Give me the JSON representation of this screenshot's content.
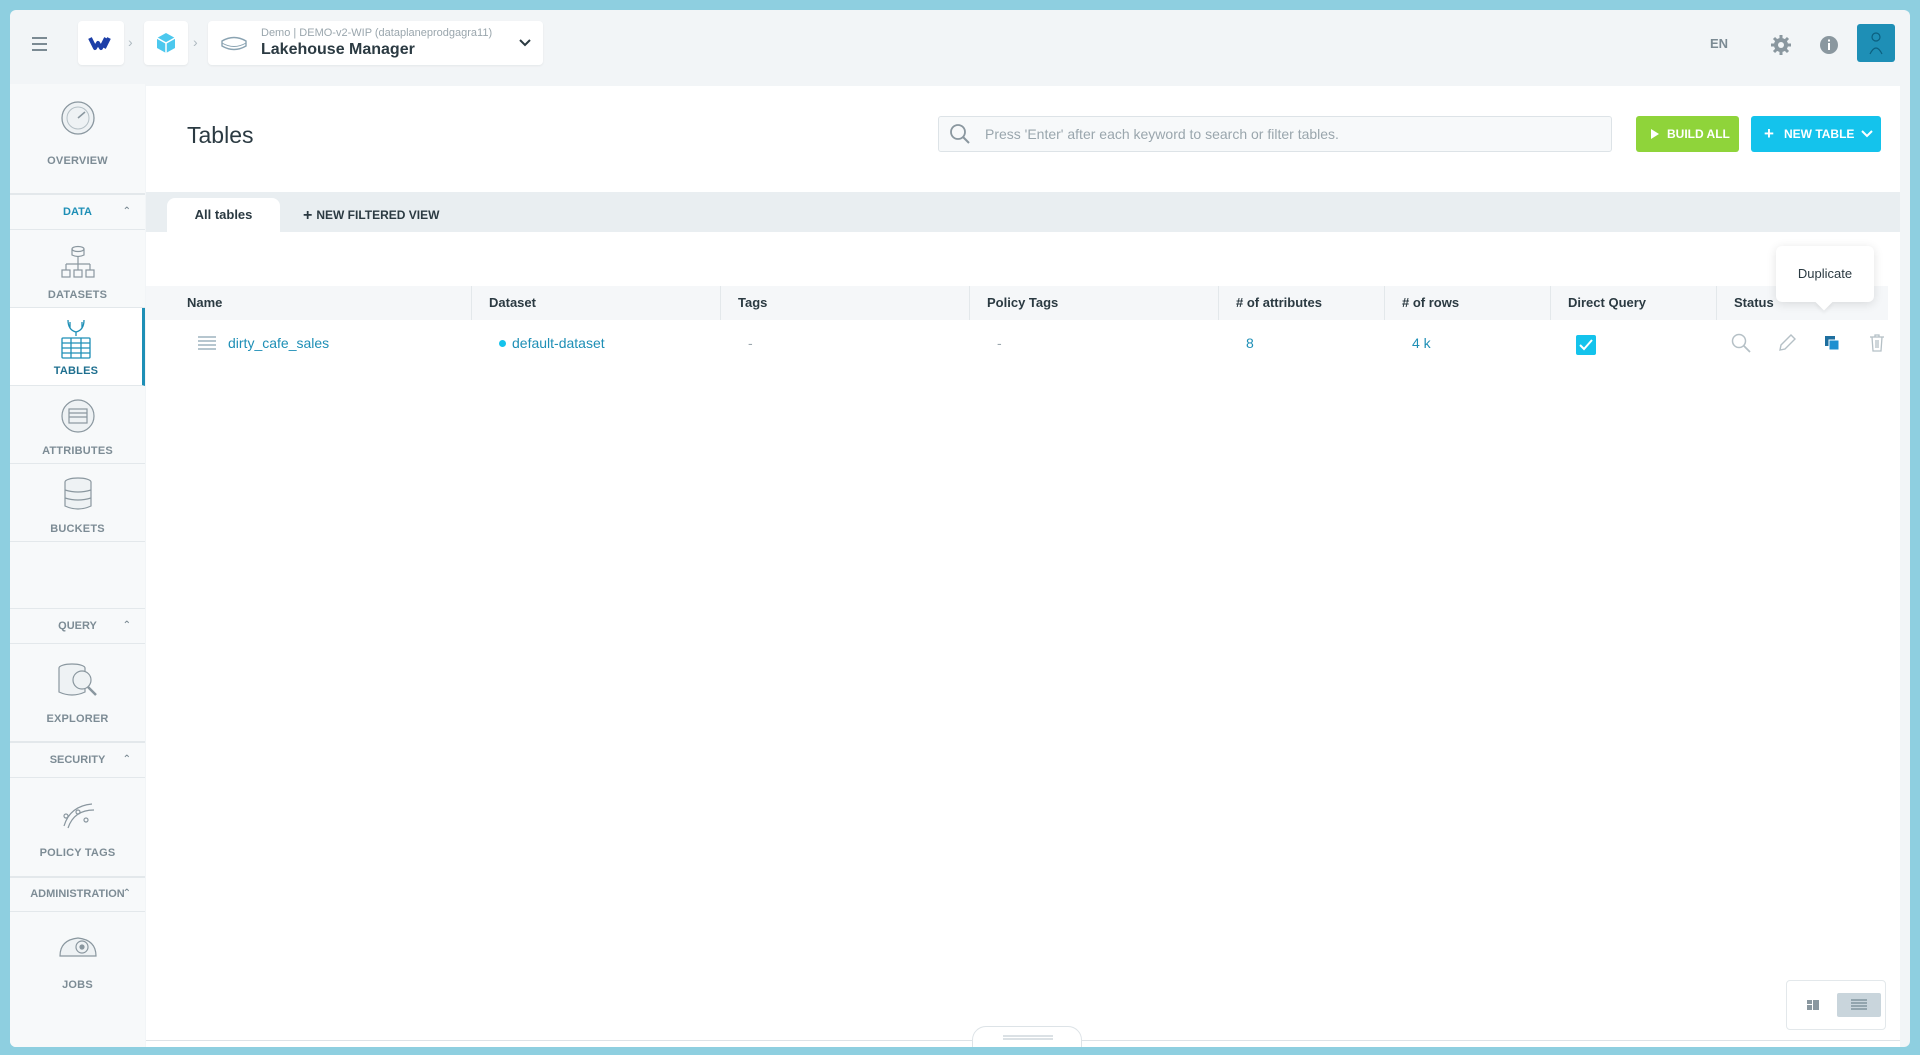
{
  "topbar": {
    "app_context": "Demo | DEMO-v2-WIP (dataplaneprodgagra11)",
    "app_title": "Lakehouse Manager",
    "language": "EN",
    "icons": [
      "menu-icon",
      "logo-icon",
      "cube-icon",
      "lakehouse-icon",
      "chevron-down-icon",
      "gear-icon",
      "info-icon",
      "user-avatar-icon"
    ]
  },
  "sidebar": {
    "overview": "OVERVIEW",
    "sections": {
      "data": "DATA",
      "query": "QUERY",
      "security": "SECURITY",
      "administration": "ADMINISTRATION"
    },
    "items": {
      "datasets": "DATASETS",
      "tables": "TABLES",
      "attributes": "ATTRIBUTES",
      "buckets": "BUCKETS",
      "explorer": "EXPLORER",
      "policy_tags": "POLICY TAGS",
      "jobs": "JOBS"
    }
  },
  "main": {
    "title": "Tables",
    "search_placeholder": "Press 'Enter' after each keyword to search or filter tables.",
    "build_all": "BUILD ALL",
    "new_table": "NEW TABLE",
    "tabs": {
      "all_tables": "All tables",
      "new_filtered_view": "NEW FILTERED VIEW"
    },
    "columns": [
      "Name",
      "Dataset",
      "Tags",
      "Policy Tags",
      "# of attributes",
      "# of rows",
      "Direct Query",
      "Status"
    ],
    "rows": [
      {
        "name": "dirty_cafe_sales",
        "dataset": "default-dataset",
        "tags": "-",
        "policy_tags": "-",
        "attributes": "8",
        "rows": "4 k",
        "direct_query": true
      }
    ],
    "tooltip": "Duplicate"
  },
  "colors": {
    "accent": "#1e8fb6",
    "build_green": "#8fd43a",
    "new_blue": "#14c3ec"
  }
}
